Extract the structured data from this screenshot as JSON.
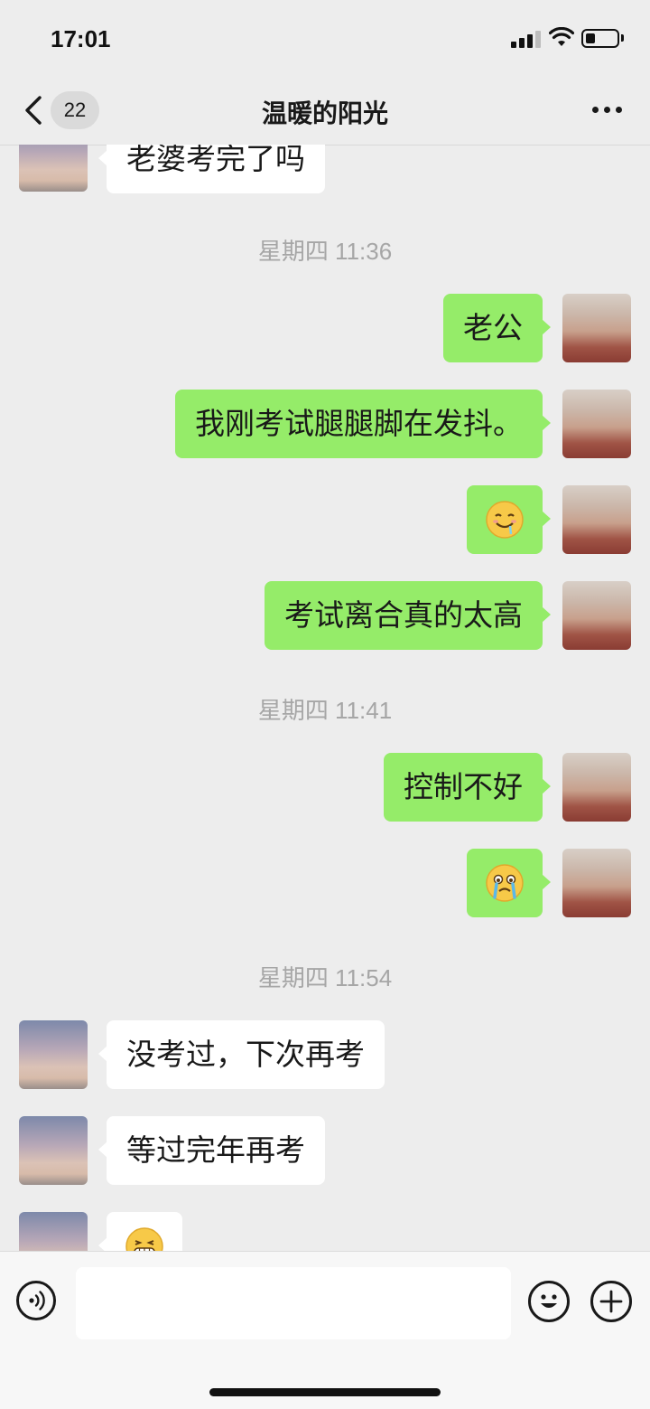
{
  "status_bar": {
    "time": "17:01"
  },
  "header": {
    "unread_count": "22",
    "title": "温暖的阳光"
  },
  "messages": [
    {
      "type": "text",
      "side": "left",
      "text": "老婆考完了吗"
    },
    {
      "type": "time",
      "text": "星期四 11:36"
    },
    {
      "type": "text",
      "side": "right",
      "text": "老公"
    },
    {
      "type": "text",
      "side": "right",
      "text": "我刚考试腿腿脚在发抖。"
    },
    {
      "type": "emoji",
      "side": "right",
      "icon": "drooling-face-emoji"
    },
    {
      "type": "text",
      "side": "right",
      "text": "考试离合真的太高"
    },
    {
      "type": "time",
      "text": "星期四 11:41"
    },
    {
      "type": "text",
      "side": "right",
      "text": "控制不好"
    },
    {
      "type": "emoji",
      "side": "right",
      "icon": "crying-face-emoji"
    },
    {
      "type": "time",
      "text": "星期四 11:54"
    },
    {
      "type": "text",
      "side": "left",
      "text": "没考过，下次再考"
    },
    {
      "type": "text",
      "side": "left",
      "text": "等过完年再考"
    },
    {
      "type": "emoji",
      "side": "left",
      "icon": "grimace-face-emoji"
    }
  ],
  "input_bar": {
    "value": "",
    "left_icon": "voice-icon",
    "right_icons": [
      "emoji-icon",
      "plus-icon"
    ]
  },
  "colors": {
    "background": "#ededed",
    "sent_bubble": "#95ec69",
    "received_bubble": "#ffffff",
    "timestamp_text": "#a6a6a6"
  }
}
